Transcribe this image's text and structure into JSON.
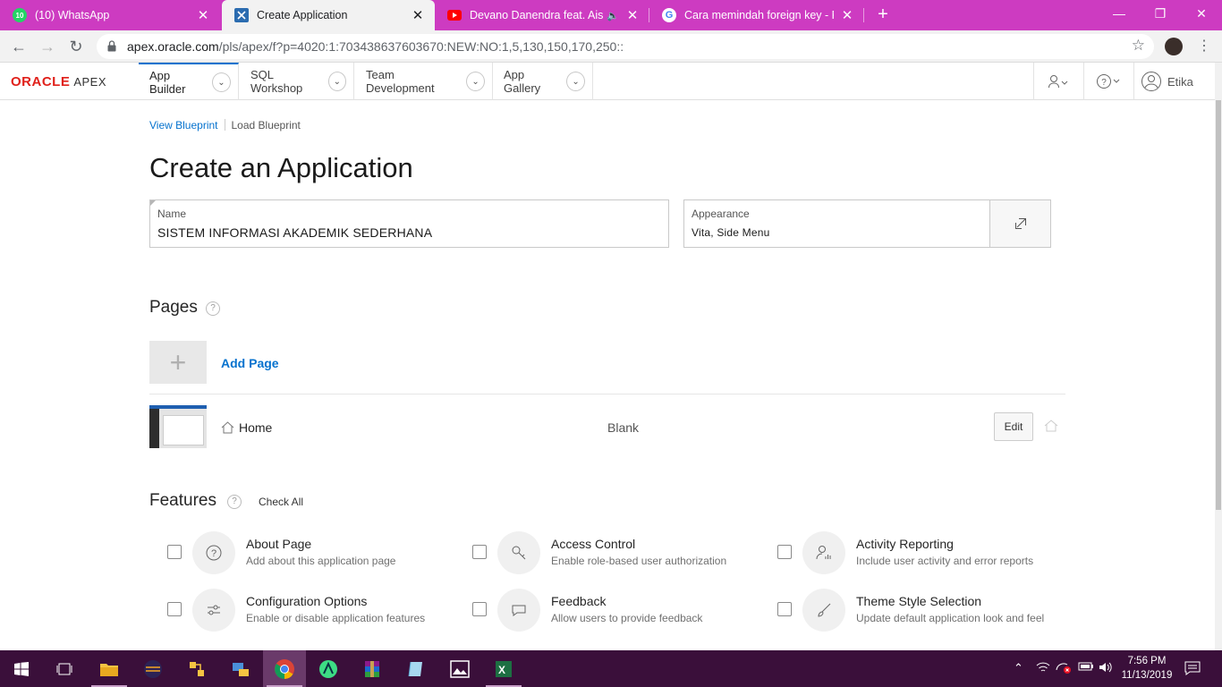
{
  "browser": {
    "tabs": [
      {
        "title": "(10) WhatsApp",
        "badge": "10"
      },
      {
        "title": "Create Application"
      },
      {
        "title": "Devano Danendra feat. Aisyah"
      },
      {
        "title": "Cara memindah foreign key - Per"
      }
    ],
    "url_host": "apex.oracle.com",
    "url_path": "/pls/apex/f?p=4020:1:703438637603670:NEW:NO:1,5,130,150,170,250::"
  },
  "apex": {
    "logo_oracle": "ORACLE",
    "logo_apex": "APEX",
    "nav": [
      "App Builder",
      "SQL Workshop",
      "Team Development",
      "App Gallery"
    ],
    "user": "Etika"
  },
  "breadcrumb": {
    "view": "View Blueprint",
    "load": "Load Blueprint"
  },
  "page_title": "Create an Application",
  "name_field": {
    "label": "Name",
    "value": "SISTEM INFORMASI AKADEMIK SEDERHANA"
  },
  "appearance_field": {
    "label": "Appearance",
    "value": "Vita, Side Menu"
  },
  "pages": {
    "heading": "Pages",
    "add_label": "Add Page",
    "rows": [
      {
        "name": "Home",
        "type": "Blank",
        "edit": "Edit"
      }
    ]
  },
  "features": {
    "heading": "Features",
    "check_all": "Check All",
    "items": [
      {
        "title": "About Page",
        "desc": "Add about this application page",
        "icon": "question-icon"
      },
      {
        "title": "Access Control",
        "desc": "Enable role-based user authorization",
        "icon": "key-icon"
      },
      {
        "title": "Activity Reporting",
        "desc": "Include user activity and error reports",
        "icon": "user-chart-icon"
      },
      {
        "title": "Configuration Options",
        "desc": "Enable or disable application features",
        "icon": "sliders-icon"
      },
      {
        "title": "Feedback",
        "desc": "Allow users to provide feedback",
        "icon": "speech-bubble-icon"
      },
      {
        "title": "Theme Style Selection",
        "desc": "Update default application look and feel",
        "icon": "brush-icon"
      }
    ]
  },
  "taskbar": {
    "time": "7:56 PM",
    "date": "11/13/2019"
  },
  "colors": {
    "tabbar": "#cd3bc1",
    "accent": "#0572ce",
    "taskbar": "#3a0f3a"
  }
}
